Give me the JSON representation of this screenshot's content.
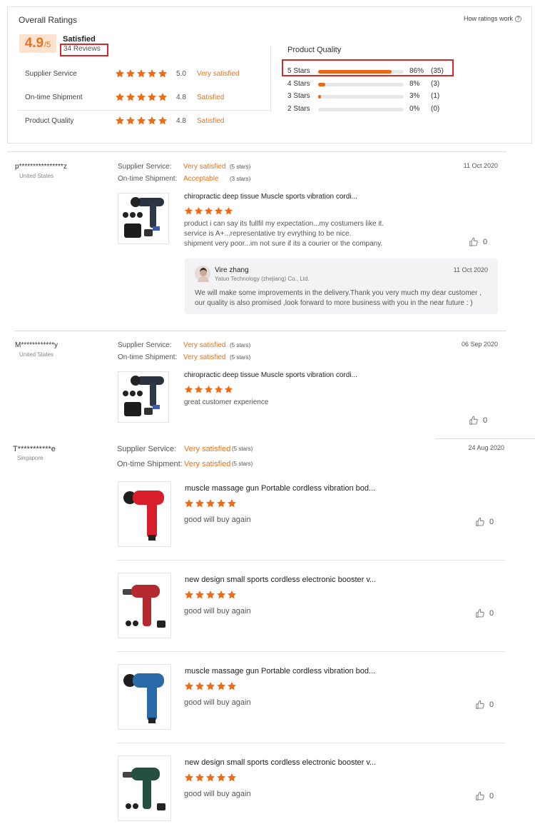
{
  "ratings": {
    "title": "Overall Ratings",
    "how_link": "How ratings work",
    "score_main": "4.9",
    "score_suffix": "/5",
    "sentiment": "Satisfied",
    "reviews_count": "34 Reviews",
    "rows": [
      {
        "label": "Supplier Service",
        "stars": 5,
        "value": "5.0",
        "text": "Very satisfied"
      },
      {
        "label": "On-time Shipment",
        "stars": 5,
        "value": "4.8",
        "text": "Satisfied"
      },
      {
        "label": "Product Quality",
        "stars": 5,
        "value": "4.8",
        "text": "Satisfied"
      }
    ],
    "distribution": {
      "title": "Product Quality",
      "rows": [
        {
          "label": "5 Stars",
          "percent": "86%",
          "count": "(35)",
          "fraction": 0.86
        },
        {
          "label": "4 Stars",
          "percent": "8%",
          "count": "(3)",
          "fraction": 0.08
        },
        {
          "label": "3 Stars",
          "percent": "3%",
          "count": "(1)",
          "fraction": 0.03
        },
        {
          "label": "2 Stars",
          "percent": "0%",
          "count": "(0)",
          "fraction": 0.0
        }
      ]
    }
  },
  "reviews": [
    {
      "user": "p****************z",
      "country": "United States",
      "date": "11 Oct 2020",
      "supplier_label": "Supplier Service:",
      "supplier_value": "Very satisfied",
      "supplier_stars": "(5 stars)",
      "shipment_label": "On-time Shipment:",
      "shipment_value": "Acceptable",
      "shipment_stars": "(3 stars)",
      "product_title": "chiropractic deep tissue Muscle sports vibration cordi...",
      "product_stars": 5,
      "text_lines": [
        "product i can say its fullfil my expectation...my costumers like it.",
        "service is A+...representative try evrything to be nice.",
        "shipment very poor...im not sure if its a courier or the company."
      ],
      "likes": "0",
      "reply": {
        "name": "Vire zhang",
        "company": "Yatuo Technology (zhejiang) Co., Ltd.",
        "date": "11 Oct 2020",
        "text": "We will make some improvements in the delivery.Thank you very much my dear customer , our quality is also promised ,look forward to more business with you in the near future : )"
      }
    },
    {
      "user": "M************y",
      "country": "United States",
      "date": "06 Sep 2020",
      "supplier_label": "Supplier Service:",
      "supplier_value": "Very satisfied",
      "supplier_stars": "(5 stars)",
      "shipment_label": "On-time Shipment:",
      "shipment_value": "Very satisfied",
      "shipment_stars": "(5 stars)",
      "product_title": "chiropractic deep tissue Muscle sports vibration cordi...",
      "product_stars": 5,
      "text": "great customer experience",
      "likes": "0"
    },
    {
      "user": "T***********e",
      "country": "Singapore",
      "date": "24 Aug 2020",
      "supplier_label": "Supplier Service:",
      "supplier_value": "Very satisfied",
      "supplier_stars": "(5 stars)",
      "shipment_label": "On-time Shipment:",
      "shipment_value": "Very satisfied",
      "shipment_stars": "(5 stars)",
      "items": [
        {
          "title": "muscle massage gun Portable cordless vibration bod...",
          "stars": 5,
          "text": "good will buy again",
          "likes": "0",
          "color": "#d81e2a"
        },
        {
          "title": "new design small sports cordless electronic booster v...",
          "stars": 5,
          "text": "good will buy again",
          "likes": "0",
          "color": "#b52a2f"
        },
        {
          "title": "muscle massage gun Portable cordless vibration bod...",
          "stars": 5,
          "text": "good will buy again",
          "likes": "0",
          "color": "#2b6aa8"
        },
        {
          "title": "new design small sports cordless electronic booster v...",
          "stars": 5,
          "text": "good will buy again",
          "likes": "0",
          "color": "#24513f"
        }
      ]
    }
  ],
  "colors": {
    "accent": "#e8731c",
    "star": "#f06a14",
    "highlight": "#d3292a"
  }
}
